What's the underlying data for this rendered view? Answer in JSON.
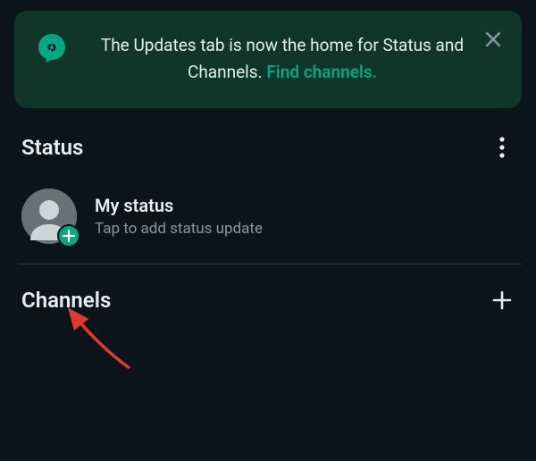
{
  "banner": {
    "icon_name": "status-ring-icon",
    "message_pre": "The Updates tab is now the home for Status and Channels. ",
    "link_text": "Find channels.",
    "close_name": "close-icon"
  },
  "status": {
    "section_title": "Status",
    "overflow_name": "more-vert-icon",
    "my_status_title": "My status",
    "my_status_sub": "Tap to add status update",
    "avatar_name": "default-avatar-icon",
    "add_badge_name": "plus-icon"
  },
  "channels": {
    "section_title": "Channels",
    "add_name": "plus-icon"
  },
  "annotation": {
    "arrow_color": "#e03a2f"
  }
}
